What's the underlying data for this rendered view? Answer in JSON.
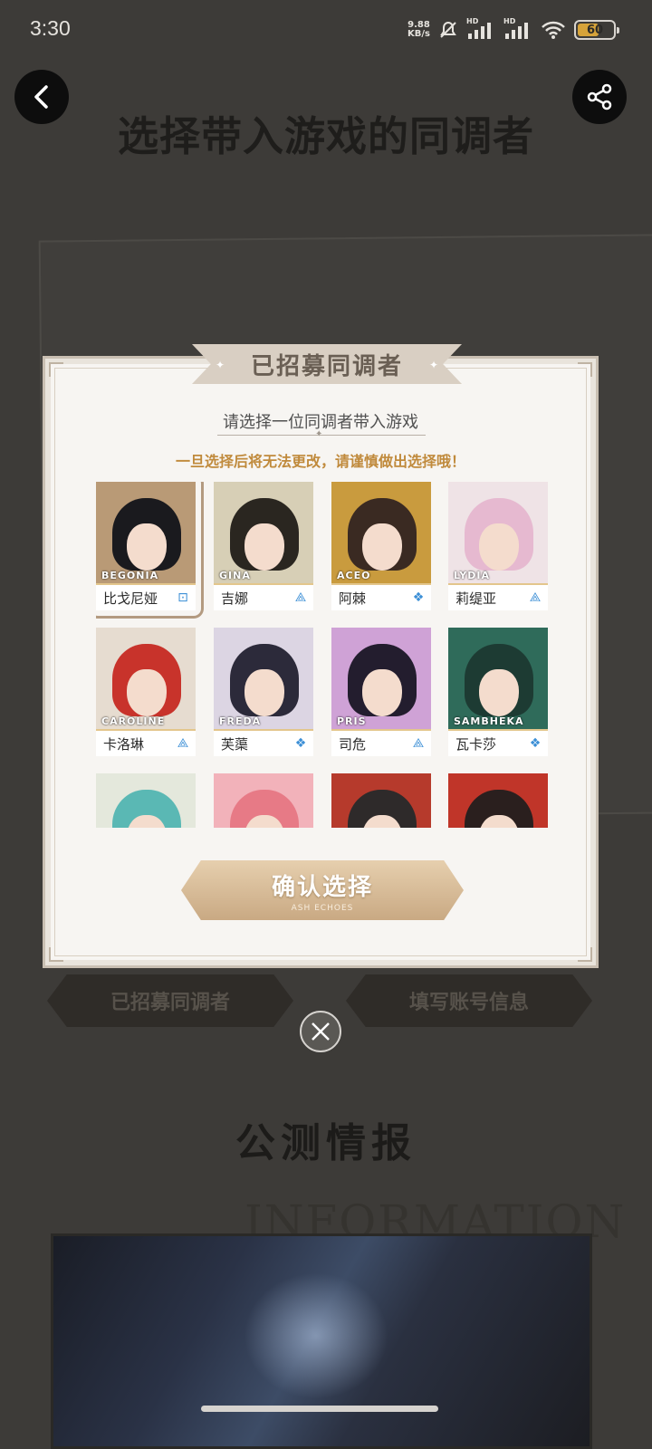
{
  "status_bar": {
    "time": "3:30",
    "net_speed_value": "9.88",
    "net_speed_unit": "KB/s",
    "network_label_1": "HD",
    "network_label_2": "HD",
    "battery": "60",
    "battery_level": 0.6
  },
  "background": {
    "title": "选择带入游戏的同调者",
    "tab_left": "已招募同调者",
    "tab_right": "填写账号信息",
    "section_title": "公测情报",
    "section_en": "INFORMATION"
  },
  "modal": {
    "title": "已招募同调者",
    "subtitle": "请选择一位同调者带入游戏",
    "warning": "一旦选择后将无法更改，请谨慎做出选择哦！",
    "characters": [
      {
        "en": "BEGONIA",
        "cn": "比戈尼娅",
        "hair": "#1a1a1e",
        "bg": "#b99a76",
        "attr_icon": "rune-icon",
        "selected": true
      },
      {
        "en": "GINA",
        "cn": "吉娜",
        "hair": "#2a2620",
        "bg": "#d7cfb6",
        "attr_icon": "triangle-icon",
        "selected": false
      },
      {
        "en": "ACEO",
        "cn": "阿棘",
        "hair": "#3a2a22",
        "bg": "#c99b3e",
        "attr_icon": "diamond-icon",
        "selected": false
      },
      {
        "en": "LYDIA",
        "cn": "莉缇亚",
        "hair": "#e6b9d0",
        "bg": "#efe3e6",
        "attr_icon": "triangle-icon",
        "selected": false
      },
      {
        "en": "CAROLINE",
        "cn": "卡洛琳",
        "hair": "#c8332b",
        "bg": "#e6dcd0",
        "attr_icon": "triangle-icon",
        "selected": false
      },
      {
        "en": "FREDA",
        "cn": "芙蕖",
        "hair": "#2c2a3a",
        "bg": "#dcd5e3",
        "attr_icon": "diamond-icon",
        "selected": false
      },
      {
        "en": "PRIS",
        "cn": "司危",
        "hair": "#231d2e",
        "bg": "#cfa2d6",
        "attr_icon": "triangle-icon",
        "selected": false
      },
      {
        "en": "SAMBHEKA",
        "cn": "瓦卡莎",
        "hair": "#1d3b33",
        "bg": "#2f6b5a",
        "attr_icon": "diamond-icon",
        "selected": false
      },
      {
        "en": "",
        "cn": "",
        "hair": "#5ab8b4",
        "bg": "#e4e8dc",
        "attr_icon": "",
        "selected": false
      },
      {
        "en": "",
        "cn": "",
        "hair": "#e77a86",
        "bg": "#f2b2ba",
        "attr_icon": "",
        "selected": false
      },
      {
        "en": "",
        "cn": "",
        "hair": "#2e2a2a",
        "bg": "#b63a2c",
        "attr_icon": "",
        "selected": false
      },
      {
        "en": "",
        "cn": "",
        "hair": "#2a1f1e",
        "bg": "#c03529",
        "attr_icon": "",
        "selected": false
      }
    ],
    "confirm_label": "确认选择",
    "confirm_sub": "ASH ECHOES"
  },
  "colors": {
    "accent_gold": "#c9a983",
    "warning_text": "#c08a3c",
    "attr_blue": "#3c8fd6"
  }
}
